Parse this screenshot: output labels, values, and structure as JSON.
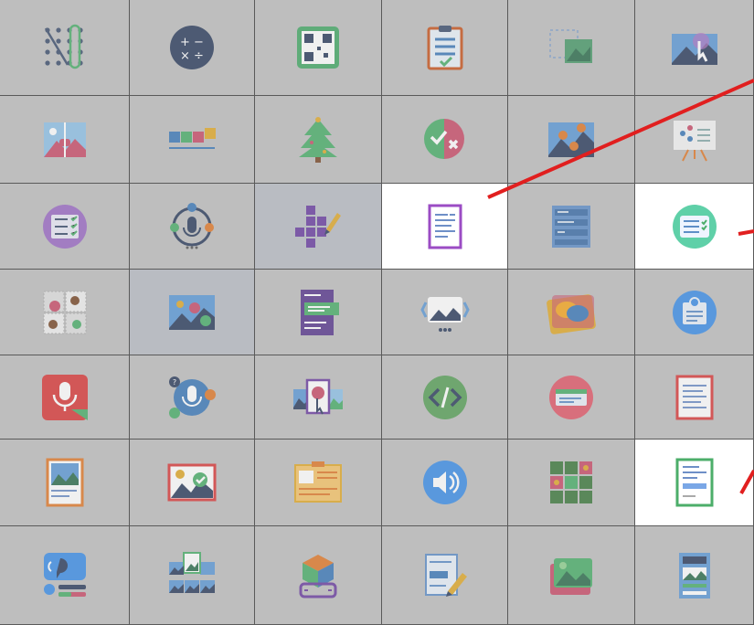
{
  "palette": {
    "highlight": "#ffffff",
    "dim": "#bdbdbd",
    "arrow": "#e11f1f"
  },
  "rows": [
    [
      {
        "icon": "dot-grid-icon"
      },
      {
        "icon": "math-operators-icon"
      },
      {
        "icon": "qr-code-icon"
      },
      {
        "icon": "clipboard-checklist-icon"
      },
      {
        "icon": "image-placeholder-icon"
      },
      {
        "icon": "image-hotspot-icon"
      }
    ],
    [
      {
        "icon": "image-slider-icon"
      },
      {
        "icon": "timeline-blocks-icon"
      },
      {
        "icon": "christmas-tree-icon"
      },
      {
        "icon": "true-false-icon"
      },
      {
        "icon": "image-pairing-icon"
      },
      {
        "icon": "presentation-icon"
      }
    ],
    [
      {
        "icon": "checklist-circle-icon"
      },
      {
        "icon": "audio-question-icon"
      },
      {
        "icon": "crossword-icon"
      },
      {
        "icon": "document-icon",
        "highlight": true
      },
      {
        "icon": "list-panel-icon"
      },
      {
        "icon": "form-checklist-icon",
        "highlight": true
      }
    ],
    [
      {
        "icon": "memory-cards-icon"
      },
      {
        "icon": "image-choice-icon"
      },
      {
        "icon": "text-blocks-icon"
      },
      {
        "icon": "image-gallery-icon"
      },
      {
        "icon": "dialog-cards-icon"
      },
      {
        "icon": "info-circle-icon"
      }
    ],
    [
      {
        "icon": "audio-recorder-icon"
      },
      {
        "icon": "speak-answer-icon"
      },
      {
        "icon": "image-sequence-icon"
      },
      {
        "icon": "code-embed-icon"
      },
      {
        "icon": "text-circle-icon"
      },
      {
        "icon": "text-page-icon"
      }
    ],
    [
      {
        "icon": "image-document-icon"
      },
      {
        "icon": "image-check-icon"
      },
      {
        "icon": "board-layout-icon"
      },
      {
        "icon": "speaker-icon"
      },
      {
        "icon": "color-grid-icon"
      },
      {
        "icon": "worksheet-icon",
        "highlight": true
      }
    ],
    [
      {
        "icon": "speech-avatar-icon"
      },
      {
        "icon": "image-collage-icon"
      },
      {
        "icon": "3d-box-icon"
      },
      {
        "icon": "edit-form-icon"
      },
      {
        "icon": "image-stack-icon"
      },
      {
        "icon": "page-layout-icon"
      }
    ]
  ]
}
